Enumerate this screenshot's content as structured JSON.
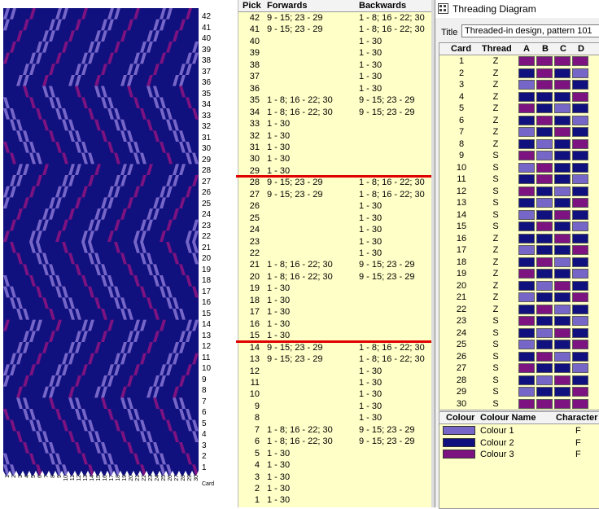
{
  "colors": {
    "A": "#7566c8",
    "B": "#10107e",
    "C": "#7c1380",
    "panel_bg": "#ffffc8",
    "red_line": "#e00000"
  },
  "pattern": {
    "row_numbers": [
      "42",
      "41",
      "40",
      "39",
      "38",
      "37",
      "36",
      "35",
      "34",
      "33",
      "32",
      "31",
      "30",
      "29",
      "28",
      "27",
      "26",
      "25",
      "24",
      "23",
      "22",
      "21",
      "20",
      "19",
      "18",
      "17",
      "16",
      "15",
      "14",
      "13",
      "12",
      "11",
      "10",
      "9",
      "8",
      "7",
      "6",
      "5",
      "4",
      "3",
      "2",
      "1"
    ],
    "column_numbers": [
      "1",
      "2",
      "3",
      "4",
      "5",
      "6",
      "7",
      "8",
      "9",
      "10",
      "11",
      "12",
      "13",
      "14",
      "15",
      "16",
      "17",
      "18",
      "19",
      "20",
      "21",
      "22",
      "23",
      "24",
      "25",
      "26",
      "27",
      "28",
      "29",
      "30"
    ],
    "axis_label": "Card"
  },
  "picks": {
    "headers": {
      "pick": "Pick",
      "forwards": "Forwards",
      "backwards": "Backwards"
    },
    "rows": [
      {
        "pick": "42",
        "fwd": "9 - 15; 23 - 29",
        "bwd": "1 - 8; 16 - 22; 30"
      },
      {
        "pick": "41",
        "fwd": "9 - 15; 23 - 29",
        "bwd": "1 - 8; 16 - 22; 30"
      },
      {
        "pick": "40",
        "fwd": "",
        "bwd": "1 - 30"
      },
      {
        "pick": "39",
        "fwd": "",
        "bwd": "1 - 30"
      },
      {
        "pick": "38",
        "fwd": "",
        "bwd": "1 - 30"
      },
      {
        "pick": "37",
        "fwd": "",
        "bwd": "1 - 30"
      },
      {
        "pick": "36",
        "fwd": "",
        "bwd": "1 - 30"
      },
      {
        "pick": "35",
        "fwd": "1 - 8; 16 - 22; 30",
        "bwd": "9 - 15; 23 - 29"
      },
      {
        "pick": "34",
        "fwd": "1 - 8; 16 - 22; 30",
        "bwd": "9 - 15; 23 - 29"
      },
      {
        "pick": "33",
        "fwd": "1 - 30",
        "bwd": ""
      },
      {
        "pick": "32",
        "fwd": "1 - 30",
        "bwd": ""
      },
      {
        "pick": "31",
        "fwd": "1 - 30",
        "bwd": ""
      },
      {
        "pick": "30",
        "fwd": "1 - 30",
        "bwd": ""
      },
      {
        "pick": "29",
        "fwd": "1 - 30",
        "bwd": ""
      },
      {
        "pick": "28",
        "fwd": "9 - 15; 23 - 29",
        "bwd": "1 - 8; 16 - 22; 30"
      },
      {
        "pick": "27",
        "fwd": "9 - 15; 23 - 29",
        "bwd": "1 - 8; 16 - 22; 30"
      },
      {
        "pick": "26",
        "fwd": "",
        "bwd": "1 - 30"
      },
      {
        "pick": "25",
        "fwd": "",
        "bwd": "1 - 30"
      },
      {
        "pick": "24",
        "fwd": "",
        "bwd": "1 - 30"
      },
      {
        "pick": "23",
        "fwd": "",
        "bwd": "1 - 30"
      },
      {
        "pick": "22",
        "fwd": "",
        "bwd": "1 - 30"
      },
      {
        "pick": "21",
        "fwd": "1 - 8; 16 - 22; 30",
        "bwd": "9 - 15; 23 - 29"
      },
      {
        "pick": "20",
        "fwd": "1 - 8; 16 - 22; 30",
        "bwd": "9 - 15; 23 - 29"
      },
      {
        "pick": "19",
        "fwd": "1 - 30",
        "bwd": ""
      },
      {
        "pick": "18",
        "fwd": "1 - 30",
        "bwd": ""
      },
      {
        "pick": "17",
        "fwd": "1 - 30",
        "bwd": ""
      },
      {
        "pick": "16",
        "fwd": "1 - 30",
        "bwd": ""
      },
      {
        "pick": "15",
        "fwd": "1 - 30",
        "bwd": ""
      },
      {
        "pick": "14",
        "fwd": "9 - 15; 23 - 29",
        "bwd": "1 - 8; 16 - 22; 30"
      },
      {
        "pick": "13",
        "fwd": "9 - 15; 23 - 29",
        "bwd": "1 - 8; 16 - 22; 30"
      },
      {
        "pick": "12",
        "fwd": "",
        "bwd": "1 - 30"
      },
      {
        "pick": "11",
        "fwd": "",
        "bwd": "1 - 30"
      },
      {
        "pick": "10",
        "fwd": "",
        "bwd": "1 - 30"
      },
      {
        "pick": "9",
        "fwd": "",
        "bwd": "1 - 30"
      },
      {
        "pick": "8",
        "fwd": "",
        "bwd": "1 - 30"
      },
      {
        "pick": "7",
        "fwd": "1 - 8; 16 - 22; 30",
        "bwd": "9 - 15; 23 - 29"
      },
      {
        "pick": "6",
        "fwd": "1 - 8; 16 - 22; 30",
        "bwd": "9 - 15; 23 - 29"
      },
      {
        "pick": "5",
        "fwd": "1 - 30",
        "bwd": ""
      },
      {
        "pick": "4",
        "fwd": "1 - 30",
        "bwd": ""
      },
      {
        "pick": "3",
        "fwd": "1 - 30",
        "bwd": ""
      },
      {
        "pick": "2",
        "fwd": "1 - 30",
        "bwd": ""
      },
      {
        "pick": "1",
        "fwd": "1 - 30",
        "bwd": ""
      }
    ]
  },
  "threading_window": {
    "title": "Threading Diagram",
    "title_label": "Title",
    "title_value": "Threaded-in design, pattern 101",
    "card_headers": {
      "card": "Card",
      "thread": "Thread",
      "a": "A",
      "b": "B",
      "c": "C",
      "d": "D"
    },
    "cards": [
      {
        "card": "1",
        "thread": "Z",
        "holes": [
          "C",
          "C",
          "C",
          "C"
        ]
      },
      {
        "card": "2",
        "thread": "Z",
        "holes": [
          "B",
          "C",
          "B",
          "A"
        ]
      },
      {
        "card": "3",
        "thread": "Z",
        "holes": [
          "A",
          "C",
          "C",
          "B"
        ]
      },
      {
        "card": "4",
        "thread": "Z",
        "holes": [
          "B",
          "B",
          "B",
          "C"
        ]
      },
      {
        "card": "5",
        "thread": "Z",
        "holes": [
          "C",
          "B",
          "A",
          "B"
        ]
      },
      {
        "card": "6",
        "thread": "Z",
        "holes": [
          "B",
          "C",
          "B",
          "A"
        ]
      },
      {
        "card": "7",
        "thread": "Z",
        "holes": [
          "A",
          "B",
          "C",
          "B"
        ]
      },
      {
        "card": "8",
        "thread": "Z",
        "holes": [
          "B",
          "A",
          "B",
          "C"
        ]
      },
      {
        "card": "9",
        "thread": "S",
        "holes": [
          "C",
          "A",
          "B",
          "B"
        ]
      },
      {
        "card": "10",
        "thread": "S",
        "holes": [
          "A",
          "C",
          "B",
          "B"
        ]
      },
      {
        "card": "11",
        "thread": "S",
        "holes": [
          "B",
          "C",
          "B",
          "A"
        ]
      },
      {
        "card": "12",
        "thread": "S",
        "holes": [
          "C",
          "B",
          "A",
          "B"
        ]
      },
      {
        "card": "13",
        "thread": "S",
        "holes": [
          "B",
          "A",
          "B",
          "C"
        ]
      },
      {
        "card": "14",
        "thread": "S",
        "holes": [
          "A",
          "B",
          "C",
          "B"
        ]
      },
      {
        "card": "15",
        "thread": "S",
        "holes": [
          "B",
          "C",
          "B",
          "A"
        ]
      },
      {
        "card": "16",
        "thread": "Z",
        "holes": [
          "B",
          "B",
          "C",
          "B"
        ]
      },
      {
        "card": "17",
        "thread": "Z",
        "holes": [
          "A",
          "B",
          "B",
          "C"
        ]
      },
      {
        "card": "18",
        "thread": "Z",
        "holes": [
          "B",
          "C",
          "A",
          "B"
        ]
      },
      {
        "card": "19",
        "thread": "Z",
        "holes": [
          "C",
          "B",
          "B",
          "A"
        ]
      },
      {
        "card": "20",
        "thread": "Z",
        "holes": [
          "B",
          "A",
          "C",
          "B"
        ]
      },
      {
        "card": "21",
        "thread": "Z",
        "holes": [
          "A",
          "B",
          "B",
          "C"
        ]
      },
      {
        "card": "22",
        "thread": "Z",
        "holes": [
          "B",
          "C",
          "A",
          "B"
        ]
      },
      {
        "card": "23",
        "thread": "S",
        "holes": [
          "C",
          "B",
          "B",
          "A"
        ]
      },
      {
        "card": "24",
        "thread": "S",
        "holes": [
          "B",
          "A",
          "C",
          "B"
        ]
      },
      {
        "card": "25",
        "thread": "S",
        "holes": [
          "A",
          "B",
          "B",
          "C"
        ]
      },
      {
        "card": "26",
        "thread": "S",
        "holes": [
          "B",
          "C",
          "A",
          "B"
        ]
      },
      {
        "card": "27",
        "thread": "S",
        "holes": [
          "C",
          "B",
          "B",
          "A"
        ]
      },
      {
        "card": "28",
        "thread": "S",
        "holes": [
          "B",
          "A",
          "C",
          "B"
        ]
      },
      {
        "card": "29",
        "thread": "S",
        "holes": [
          "A",
          "B",
          "B",
          "C"
        ]
      },
      {
        "card": "30",
        "thread": "S",
        "holes": [
          "C",
          "C",
          "C",
          "C"
        ]
      }
    ],
    "colour_headers": {
      "colour": "Colour",
      "name": "Colour Name",
      "character": "Character"
    },
    "colours": [
      {
        "key": "A",
        "name": "Colour 1",
        "character": "F"
      },
      {
        "key": "B",
        "name": "Colour 2",
        "character": "F"
      },
      {
        "key": "C",
        "name": "Colour 3",
        "character": "F"
      }
    ]
  }
}
